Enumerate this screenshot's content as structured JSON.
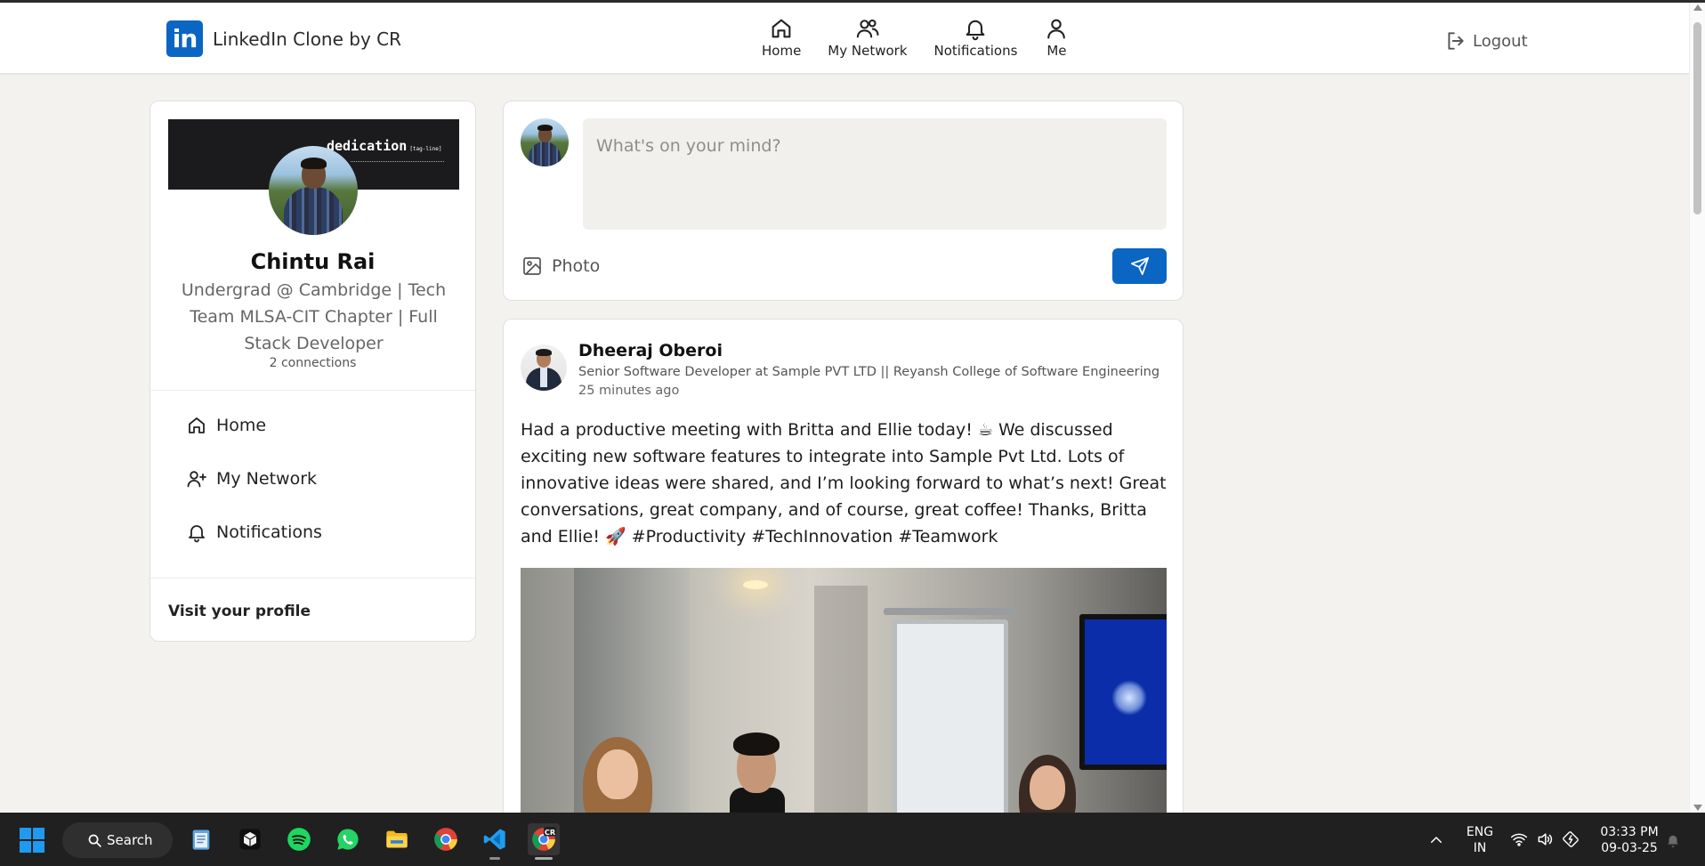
{
  "header": {
    "brand_logo_text": "in",
    "brand_name": "LinkedIn Clone by CR",
    "nav": [
      {
        "label": "Home",
        "icon": "home-icon"
      },
      {
        "label": "My Network",
        "icon": "network-icon"
      },
      {
        "label": "Notifications",
        "icon": "bell-icon"
      },
      {
        "label": "Me",
        "icon": "user-icon"
      }
    ],
    "logout_label": "Logout"
  },
  "profile": {
    "cover_text": "dedication",
    "cover_small_text": "[tag-line]",
    "name": "Chintu Rai",
    "headline": "Undergrad @ Cambridge | Tech Team MLSA-CIT Chapter | Full Stack Developer",
    "connections": "2 connections",
    "nav": [
      {
        "label": "Home",
        "icon": "home-icon"
      },
      {
        "label": "My Network",
        "icon": "user-plus-icon"
      },
      {
        "label": "Notifications",
        "icon": "bell-icon"
      }
    ],
    "visit_profile": "Visit your profile"
  },
  "composer": {
    "placeholder": "What's on your mind?",
    "value": "",
    "photo_label": "Photo"
  },
  "post": {
    "author": "Dheeraj Oberoi",
    "author_title": "Senior Software Developer at Sample PVT LTD || Reyansh College of Software Engineering",
    "time": "25 minutes ago",
    "body": "Had a productive meeting with Britta and Ellie today! ☕ We discussed exciting new software features to integrate into Sample Pvt Ltd. Lots of innovative ideas were shared, and I’m looking forward to what’s next! Great conversations, great company, and of course, great coffee! Thanks, Britta and Ellie! 🚀 #Productivity #TechInnovation #Teamwork"
  },
  "taskbar": {
    "search_label": "Search",
    "lang_line1": "ENG",
    "lang_line2": "IN",
    "time": "03:33 PM",
    "date": "09-03-25",
    "chrome_badge": "CR"
  },
  "colors": {
    "accent": "#0a66c2",
    "background": "#f3f2ef",
    "taskbar": "#202020"
  }
}
